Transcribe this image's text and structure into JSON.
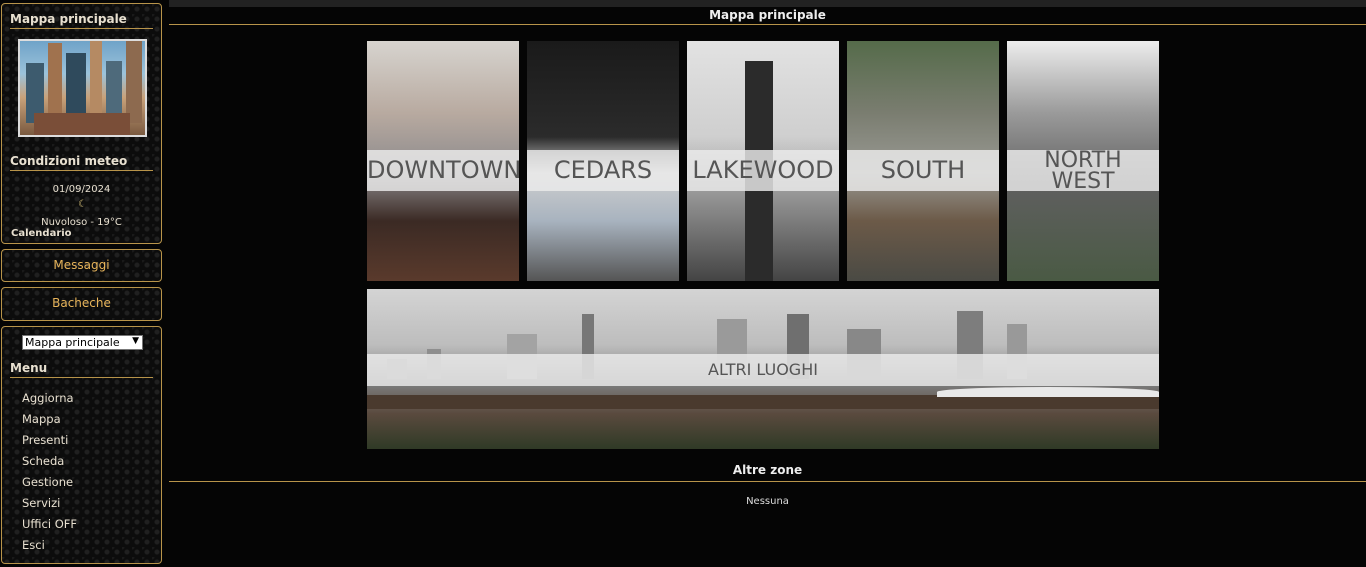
{
  "sidebar": {
    "map_title": "Mappa principale",
    "meteo_title": "Condizioni meteo",
    "date": "01/09/2024",
    "weather": "Nuvoloso - 19°C",
    "calendar": "Calendario",
    "messages": "Messaggi",
    "boards": "Bacheche",
    "map_select_value": "Mappa principale",
    "menu_title": "Menu",
    "menu": [
      "Aggiorna",
      "Mappa",
      "Presenti",
      "Scheda",
      "Gestione",
      "Servizi",
      "Uffici OFF",
      "Esci"
    ]
  },
  "main": {
    "title": "Mappa principale",
    "tiles": [
      {
        "line1": "DOWNTOWN",
        "line2": ""
      },
      {
        "line1": "CEDARS",
        "line2": ""
      },
      {
        "line1": "LAKEWOOD",
        "line2": ""
      },
      {
        "line1": "SOUTH",
        "line2": ""
      },
      {
        "line1": "NORTH",
        "line2": "WEST"
      }
    ],
    "wide_tile": "ALTRI LUOGHI",
    "other_zones_title": "Altre zone",
    "other_zones_value": "Nessuna"
  },
  "colors": {
    "accent": "#b8944a",
    "link": "#e7b45a"
  },
  "icons": {
    "weather": "moon-icon"
  }
}
